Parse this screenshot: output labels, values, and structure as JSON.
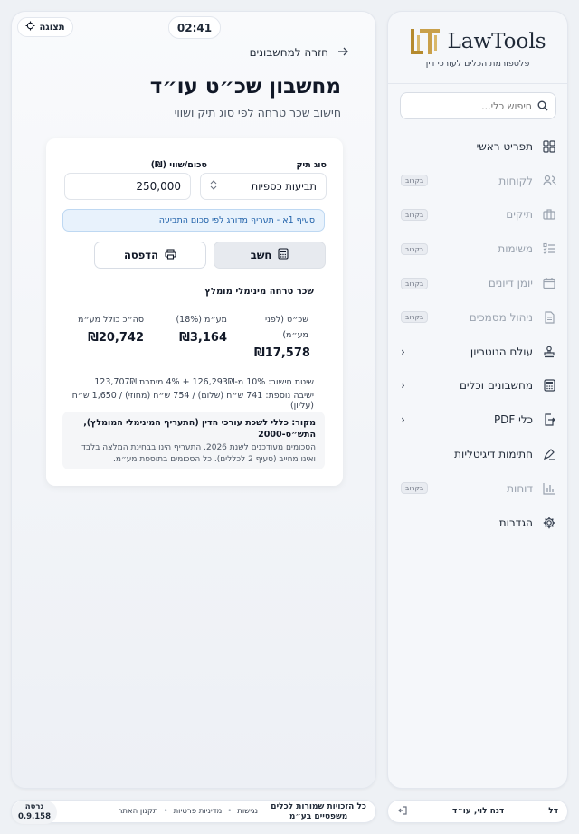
{
  "app": {
    "logo_text": "LawTools",
    "logo_subtitle": "פלטפורמת הכלים לעורכי דין",
    "brand_color": "#b58a2e"
  },
  "search": {
    "placeholder": "חיפוש כלי..."
  },
  "sidebar": {
    "items": [
      {
        "label": "תפריט ראשי",
        "icon": "grid-icon",
        "badge": "",
        "dim": false,
        "chevron": false
      },
      {
        "label": "לקוחות",
        "icon": "users-icon",
        "badge": "בקרוב",
        "dim": true,
        "chevron": false
      },
      {
        "label": "תיקים",
        "icon": "briefcase-icon",
        "badge": "בקרוב",
        "dim": true,
        "chevron": false
      },
      {
        "label": "משימות",
        "icon": "checklist-icon",
        "badge": "בקרוב",
        "dim": true,
        "chevron": false
      },
      {
        "label": "יומן דיונים",
        "icon": "calendar-icon",
        "badge": "בקרוב",
        "dim": true,
        "chevron": false
      },
      {
        "label": "ניהול מסמכים",
        "icon": "document-icon",
        "badge": "בקרוב",
        "dim": true,
        "chevron": false
      },
      {
        "label": "עולם הנוטריון",
        "icon": "stamp-icon",
        "badge": "",
        "dim": false,
        "chevron": true
      },
      {
        "label": "מחשבונים וכלים",
        "icon": "calculator-icon",
        "badge": "",
        "dim": false,
        "chevron": true
      },
      {
        "label": "כלי PDF",
        "icon": "pdf-export-icon",
        "badge": "",
        "dim": false,
        "chevron": true
      },
      {
        "label": "חתימות דיגיטליות",
        "icon": "signature-pen-icon",
        "badge": "",
        "dim": false,
        "chevron": false
      },
      {
        "label": "דוחות",
        "icon": "bar-chart-icon",
        "badge": "בקרוב",
        "dim": true,
        "chevron": false
      },
      {
        "label": "הגדרות",
        "icon": "gear-icon",
        "badge": "",
        "dim": false,
        "chevron": false
      }
    ]
  },
  "user": {
    "initials": "דל",
    "name": "דנה לוי, עו״ד"
  },
  "topbar": {
    "timer": "02:41",
    "preview_label": "תצוגה"
  },
  "page": {
    "back_label": "חזרה למחשבונים",
    "title": "מחשבון שכ״ט עו״ד",
    "subtitle": "חישוב שכר טרחה לפי סוג תיק ושווי"
  },
  "form": {
    "case_type_label": "סוג תיק",
    "case_type_value": "תביעות כספיות",
    "amount_label": "סכום/שווי (₪)",
    "amount_value": "250,000",
    "info_text": "סעיף 1א - תעריף מדורג לפי סכום התביעה",
    "calc_label": "חשב",
    "print_label": "הדפסה"
  },
  "results": {
    "title": "שכר טרחה מינימלי מומלץ",
    "fee_label_1": "שכ״ט (לפני",
    "fee_label_2": "מע״מ)",
    "fee_value": "₪17,578",
    "vat_label": "מע״מ (18%)",
    "vat_value": "₪3,164",
    "total_label": "סה״כ כולל מע״מ",
    "total_value": "₪20,742",
    "method_line": "שיטת חישוב: 10% מ-126,293₪ + 4% מיתרת 123,707₪",
    "sessions_line": "ישיבה נוספת: 741 ש״ח (שלום) / 754 ש״ח (מחוזי) / 1,650 ש״ח (עליון)"
  },
  "source": {
    "title_1": "מקור: כללי לשכת עורכי הדין (התעריף המינימלי המומלץ),",
    "title_2": "התש״ס-2000",
    "desc_1": "הסכומים מעודכנים לשנת 2026. התעריף הינו בבחינת המלצה בלבד",
    "desc_2": "ואינו מחייב (סעיף 2 לכללים). כל הסכומים בתוספת מע״מ."
  },
  "footer": {
    "copyright_1": "כל הזכויות שמורות לכלים",
    "copyright_2": "משפטיים בע״מ",
    "links": [
      "נגישות",
      "מדיניות פרטיות",
      "תקנון האתר"
    ],
    "version_label": "גרסה",
    "version_value": "0.9.158"
  }
}
